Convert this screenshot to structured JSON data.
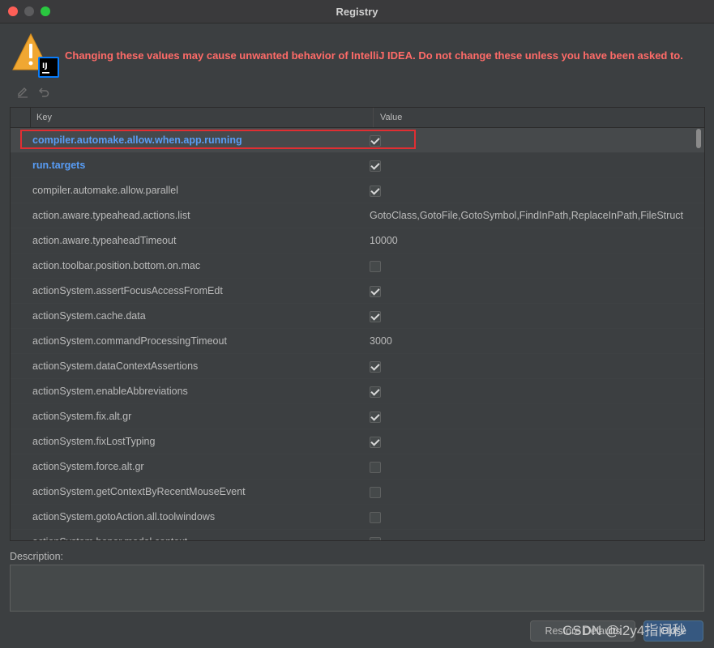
{
  "window": {
    "title": "Registry"
  },
  "warning": {
    "message": "Changing these values may cause unwanted behavior of IntelliJ IDEA. Do not change these unless you have been asked to.",
    "app_badge": "IJ"
  },
  "toolbar": {
    "edit_icon": "pencil-icon",
    "revert_icon": "undo-icon"
  },
  "table": {
    "headers": {
      "key": "Key",
      "value": "Value"
    },
    "rows": [
      {
        "key": "compiler.automake.allow.when.app.running",
        "type": "bool",
        "checked": true,
        "value": "",
        "modified": true,
        "selected": true
      },
      {
        "key": "run.targets",
        "type": "bool",
        "checked": true,
        "value": "",
        "modified": true
      },
      {
        "key": "compiler.automake.allow.parallel",
        "type": "bool",
        "checked": true,
        "value": ""
      },
      {
        "key": "action.aware.typeahead.actions.list",
        "type": "text",
        "value": "GotoClass,GotoFile,GotoSymbol,FindInPath,ReplaceInPath,FileStruct"
      },
      {
        "key": "action.aware.typeaheadTimeout",
        "type": "text",
        "value": "10000"
      },
      {
        "key": "action.toolbar.position.bottom.on.mac",
        "type": "bool",
        "checked": false,
        "value": ""
      },
      {
        "key": "actionSystem.assertFocusAccessFromEdt",
        "type": "bool",
        "checked": true,
        "value": ""
      },
      {
        "key": "actionSystem.cache.data",
        "type": "bool",
        "checked": true,
        "value": ""
      },
      {
        "key": "actionSystem.commandProcessingTimeout",
        "type": "text",
        "value": "3000"
      },
      {
        "key": "actionSystem.dataContextAssertions",
        "type": "bool",
        "checked": true,
        "value": ""
      },
      {
        "key": "actionSystem.enableAbbreviations",
        "type": "bool",
        "checked": true,
        "value": ""
      },
      {
        "key": "actionSystem.fix.alt.gr",
        "type": "bool",
        "checked": true,
        "value": ""
      },
      {
        "key": "actionSystem.fixLostTyping",
        "type": "bool",
        "checked": true,
        "value": ""
      },
      {
        "key": "actionSystem.force.alt.gr",
        "type": "bool",
        "checked": false,
        "value": ""
      },
      {
        "key": "actionSystem.getContextByRecentMouseEvent",
        "type": "bool",
        "checked": false,
        "value": ""
      },
      {
        "key": "actionSystem.gotoAction.all.toolwindows",
        "type": "bool",
        "checked": false,
        "value": ""
      },
      {
        "key": "actionSystem.honor.modal.context",
        "type": "bool",
        "checked": false,
        "value": ""
      }
    ]
  },
  "description": {
    "label": "Description:",
    "text": ""
  },
  "buttons": {
    "restore": "Restore Defaults",
    "close": "Close"
  },
  "watermark": "CSDN @i2y4指间秒"
}
